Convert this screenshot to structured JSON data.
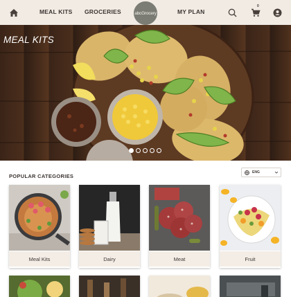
{
  "header": {
    "home_icon": "home-icon",
    "nav": [
      {
        "label": "MEAL KITS"
      },
      {
        "label": "GROCERIES"
      },
      {
        "label": "MY PLAN"
      }
    ],
    "logo_text": "abcGrocery",
    "search_icon": "search-icon",
    "cart_icon": "cart-icon",
    "cart_count": "0",
    "account_icon": "account-icon"
  },
  "hero": {
    "title": "MEAL KITS",
    "slides": 5,
    "active_slide": 0
  },
  "categories": {
    "title": "POPULAR CATEGORIES",
    "language": "ENG",
    "items": [
      {
        "label": "Meal Kits"
      },
      {
        "label": "Dairy"
      },
      {
        "label": "Meat"
      },
      {
        "label": "Fruit"
      }
    ]
  },
  "colors": {
    "header_bg": "#f1ebe4",
    "label_bg": "#f3ede6",
    "text": "#3d3532"
  }
}
